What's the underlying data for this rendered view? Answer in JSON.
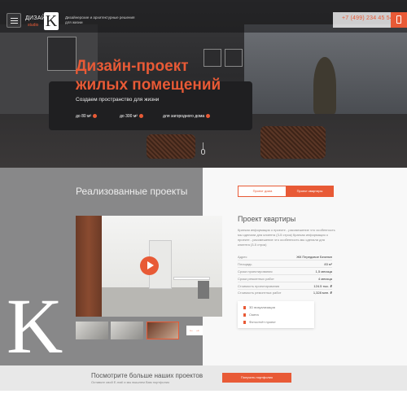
{
  "header": {
    "logo_text": "ДИЗАЙН",
    "logo_sub": "studio",
    "logo_letter": "K",
    "tagline": "Дизайнерские и архитектурные решения для жизни",
    "phone": "+7 (499) 234 45 54"
  },
  "hero": {
    "title_line1": "Дизайн-проект",
    "title_line2": "жилых помещений",
    "subtitle": "Создаем пространство для жизни",
    "features": [
      "до 80 м²",
      "до 300 м²",
      "для загородного дома"
    ]
  },
  "projects": {
    "heading": "Реализованные проекты",
    "big_letter": "K",
    "tabs": [
      "Проект дома",
      "Проект квартиры"
    ],
    "active_tab": "Проект квартиры",
    "detail_title": "Проект квартиры",
    "detail_desc": "Краткая информация о проекте - рассмешение что особенность мы сделали для клиента (3-5 строк) Краткая информация о проекте - рассмешение что особенность мы сделали для клиента (3-5 строк)",
    "specs": [
      {
        "label": "Адрес",
        "value": "ЖК Передовое Безенкн"
      },
      {
        "label": "Площадь",
        "value": "83 м²"
      },
      {
        "label": "Сроки проектирования",
        "value": "1,5 месяца"
      },
      {
        "label": "Сроки ремонтных работ",
        "value": "4 месяца"
      },
      {
        "label": "Стоимость проектирования",
        "value": "124.5 тыс. ₽"
      },
      {
        "label": "Стоимость ремонтных работ",
        "value": "1,328 млн. ₽"
      }
    ],
    "files": [
      "3D визуализация",
      "Смета",
      "Фотоотчёт проект"
    ],
    "arrows": "← →"
  },
  "more": {
    "title": "Посмотрите больше наших проектов",
    "subtitle": "Оставьте свой E-mail и мы вышлем Вам портфолио",
    "button": "Получить портфолио"
  },
  "colors": {
    "accent": "#e85a36",
    "dark": "#2b2b2d",
    "gray_panel": "#888889"
  }
}
